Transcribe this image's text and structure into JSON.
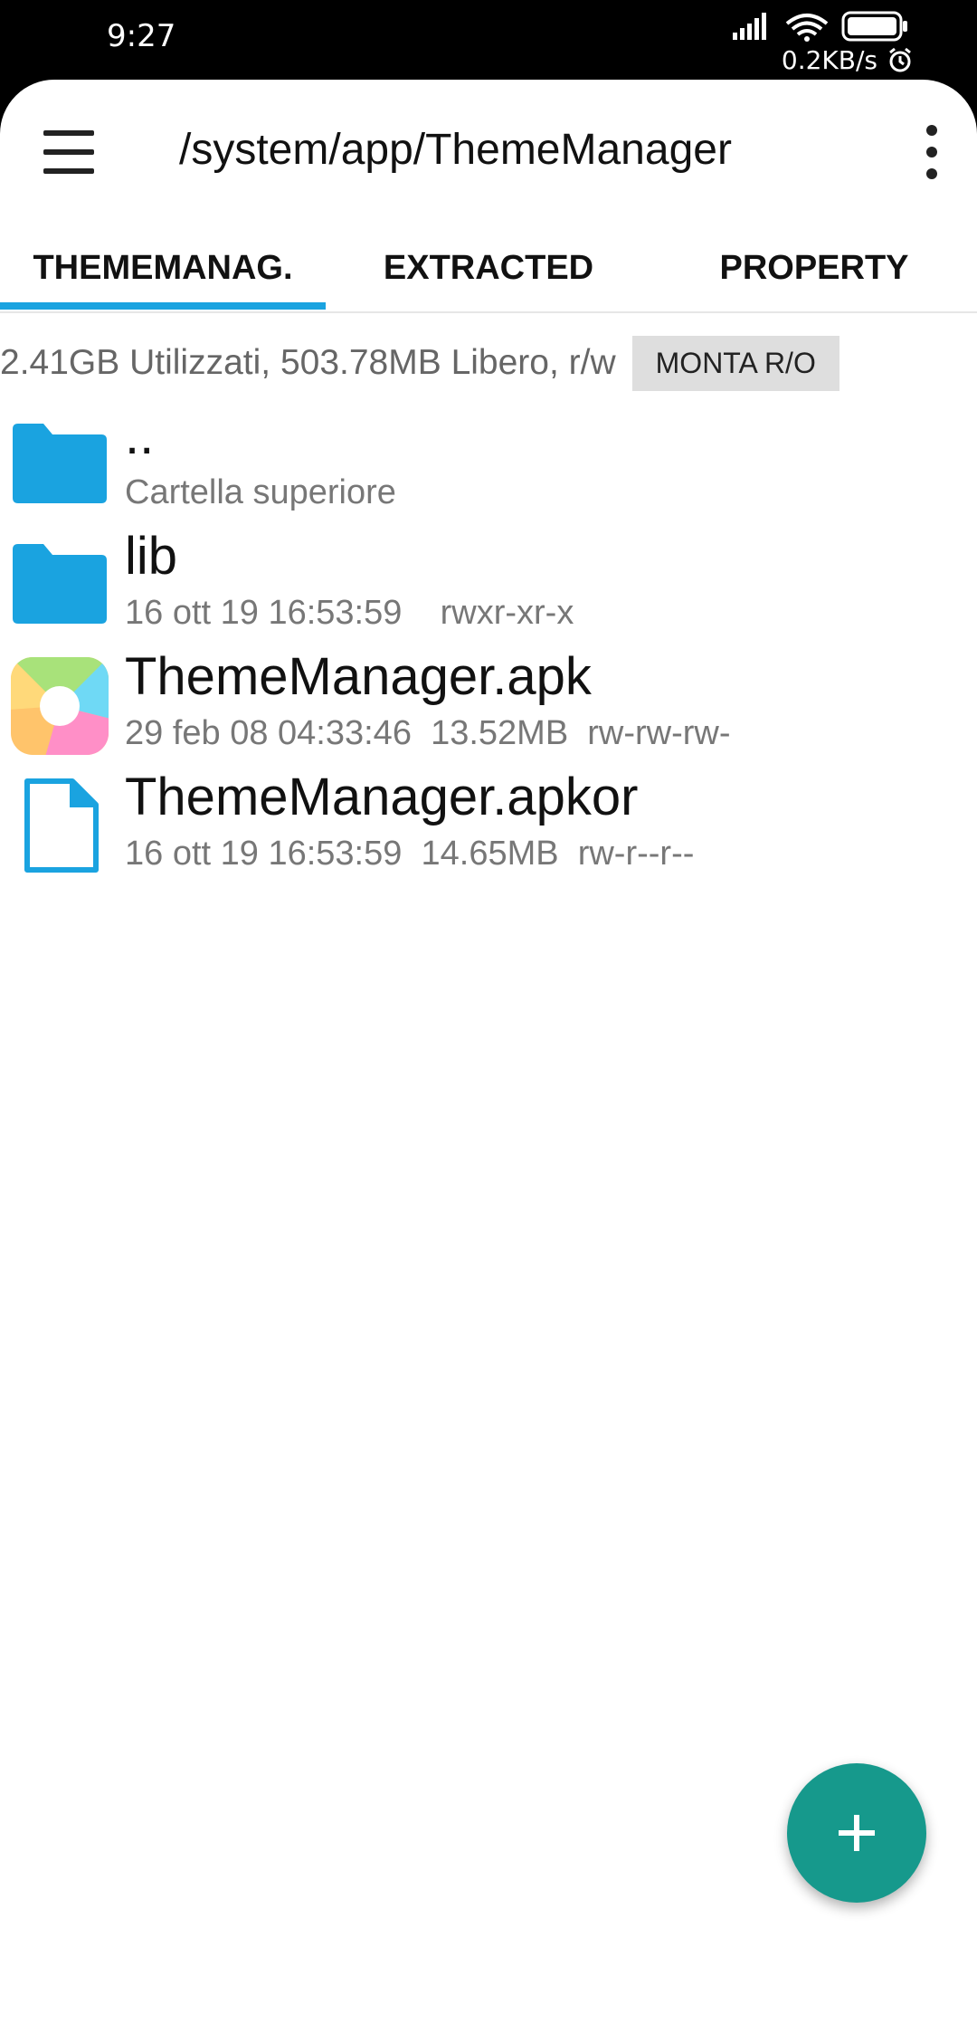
{
  "status_bar": {
    "time": "9:27",
    "speed": "0.2KB/s"
  },
  "toolbar": {
    "path": "/system/app/ThemeManager",
    "menu_icon": "hamburger-icon",
    "more_icon": "more-vert-icon"
  },
  "tabs": [
    {
      "label": "THEMEMANAG."
    },
    {
      "label": "EXTRACTED"
    },
    {
      "label": "PROPERTY"
    }
  ],
  "storage": {
    "info": "2.41GB Utilizzati, 503.78MB Libero, r/w",
    "mount_label": "MONTA R/O"
  },
  "files": [
    {
      "name": "..",
      "meta": "Cartella superiore",
      "icon": "folder-icon"
    },
    {
      "name": "lib",
      "meta": "16 ott 19 16:53:59    rwxr-xr-x",
      "icon": "folder-icon"
    },
    {
      "name": "ThemeManager.apk",
      "meta": "29 feb 08 04:33:46  13.52MB  rw-rw-rw-",
      "icon": "app-icon"
    },
    {
      "name": "ThemeManager.apkor",
      "meta": "16 ott 19 16:53:59  14.65MB  rw-r--r--",
      "icon": "file-icon"
    }
  ],
  "colors": {
    "accent": "#1aa3e0",
    "fab": "#16998c",
    "folder": "#1aa3e0"
  }
}
